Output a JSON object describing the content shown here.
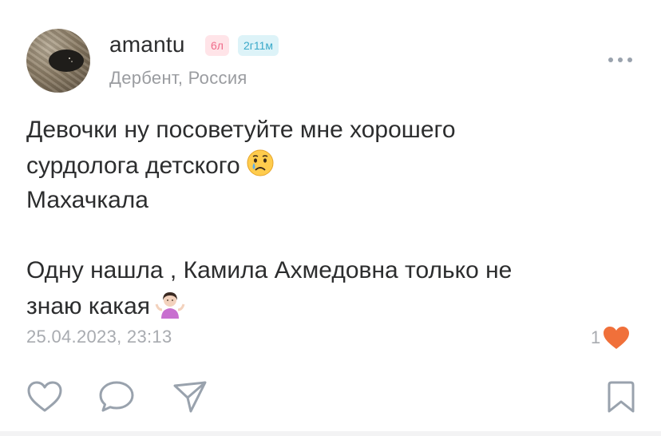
{
  "post": {
    "author": {
      "username": "amantu",
      "age_tag": "6л",
      "time_tag": "2г11м",
      "location": "Дербент, Россия"
    },
    "text_lines": [
      "Девочки ну посоветуйте мне хорошего",
      "сурдолога детского",
      "Махачкала",
      "",
      "Одну нашла , Камила Ахмедовна только не",
      "знаю какая"
    ],
    "emojis": [
      "crying-face",
      "woman-shrugging"
    ],
    "timestamp": "25.04.2023, 23:13",
    "likes_count": "1"
  },
  "actions": {
    "icons": [
      "heart-outline-icon",
      "comment-icon",
      "share-icon",
      "bookmark-icon"
    ]
  },
  "colors": {
    "text": "#2c2d2e",
    "secondary": "#9a9ca0",
    "age_tag_bg": "#ffe4e8",
    "age_tag_fg": "#f06b8a",
    "time_tag_bg": "#ddf3f8",
    "time_tag_fg": "#3aa9c9",
    "liked_heart": "#f0703a",
    "icon_gray": "#99a2ad"
  }
}
